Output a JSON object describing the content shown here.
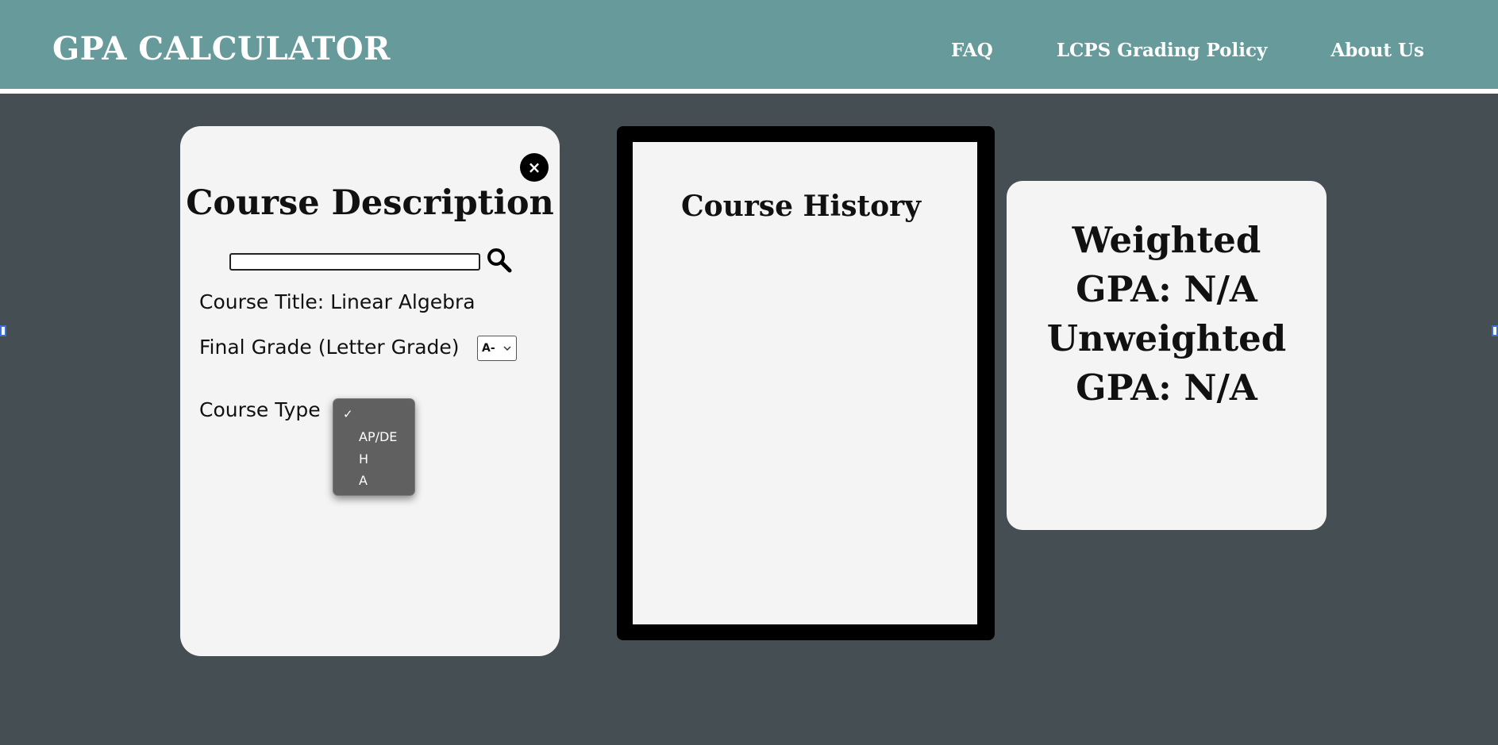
{
  "header": {
    "brand": "GPA CALCULATOR",
    "nav": [
      "FAQ",
      "LCPS Grading Policy",
      "About Us"
    ]
  },
  "course_description": {
    "close_glyph": "×",
    "title": "Course Description",
    "search": {
      "value": "",
      "placeholder": ""
    },
    "course_title_label": "Course Title: Linear Algebra",
    "final_grade_label": "Final Grade (Letter Grade)",
    "final_grade_value": "A-",
    "course_type_label": "Course Type",
    "course_type_menu": {
      "selected_check": "✓",
      "options": [
        "AP/DE",
        "H",
        "A"
      ]
    }
  },
  "course_history": {
    "title": "Course History"
  },
  "gpa": {
    "weighted_line1": "Weighted",
    "weighted_line2": "GPA: N/A",
    "unweighted_line1": "Unweighted",
    "unweighted_line2": "GPA: N/A"
  },
  "colors": {
    "header_bg": "#669a9b",
    "page_bg": "#454e53",
    "card_bg": "#f4f4f4",
    "menu_bg": "#606060"
  },
  "icons": [
    "close-icon",
    "search-icon",
    "chevron-down-icon",
    "checkmark-icon"
  ]
}
